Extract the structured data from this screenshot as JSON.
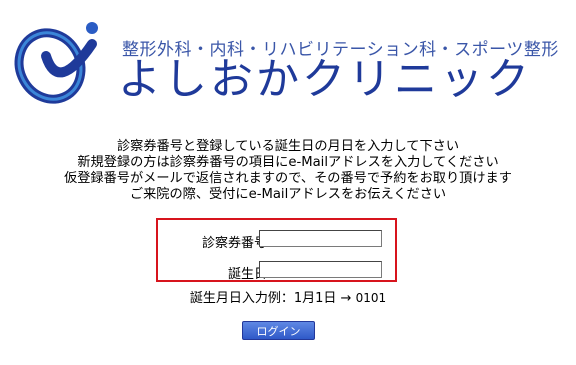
{
  "header": {
    "subtitle": "整形外科・内科・リハビリテーション科・スポーツ整形",
    "clinic_name": "よしおかクリニック",
    "logo": "clinic-logo-icon",
    "brand_color": "#1f3a9a"
  },
  "instructions": {
    "line1": "診察券番号と登録している誕生日の月日を入力して下さい",
    "line2": "新規登録の方は診察券番号の項目にe-Mailアドレスを入力してください",
    "line3": "仮登録番号がメールで返信されますので、その番号で予約をお取り頂けます",
    "line4": "ご来院の際、受付にe-Mailアドレスをお伝えください"
  },
  "form": {
    "card_number_label": "診察券番号",
    "card_number_value": "",
    "birthday_label": "誕生日",
    "birthday_value": "",
    "highlight_color": "#d7141d"
  },
  "example": {
    "text": "誕生月日入力例：1月1日 → ",
    "value": "0101"
  },
  "login_button": {
    "label": "ログイン",
    "color": "#2f59c8"
  }
}
